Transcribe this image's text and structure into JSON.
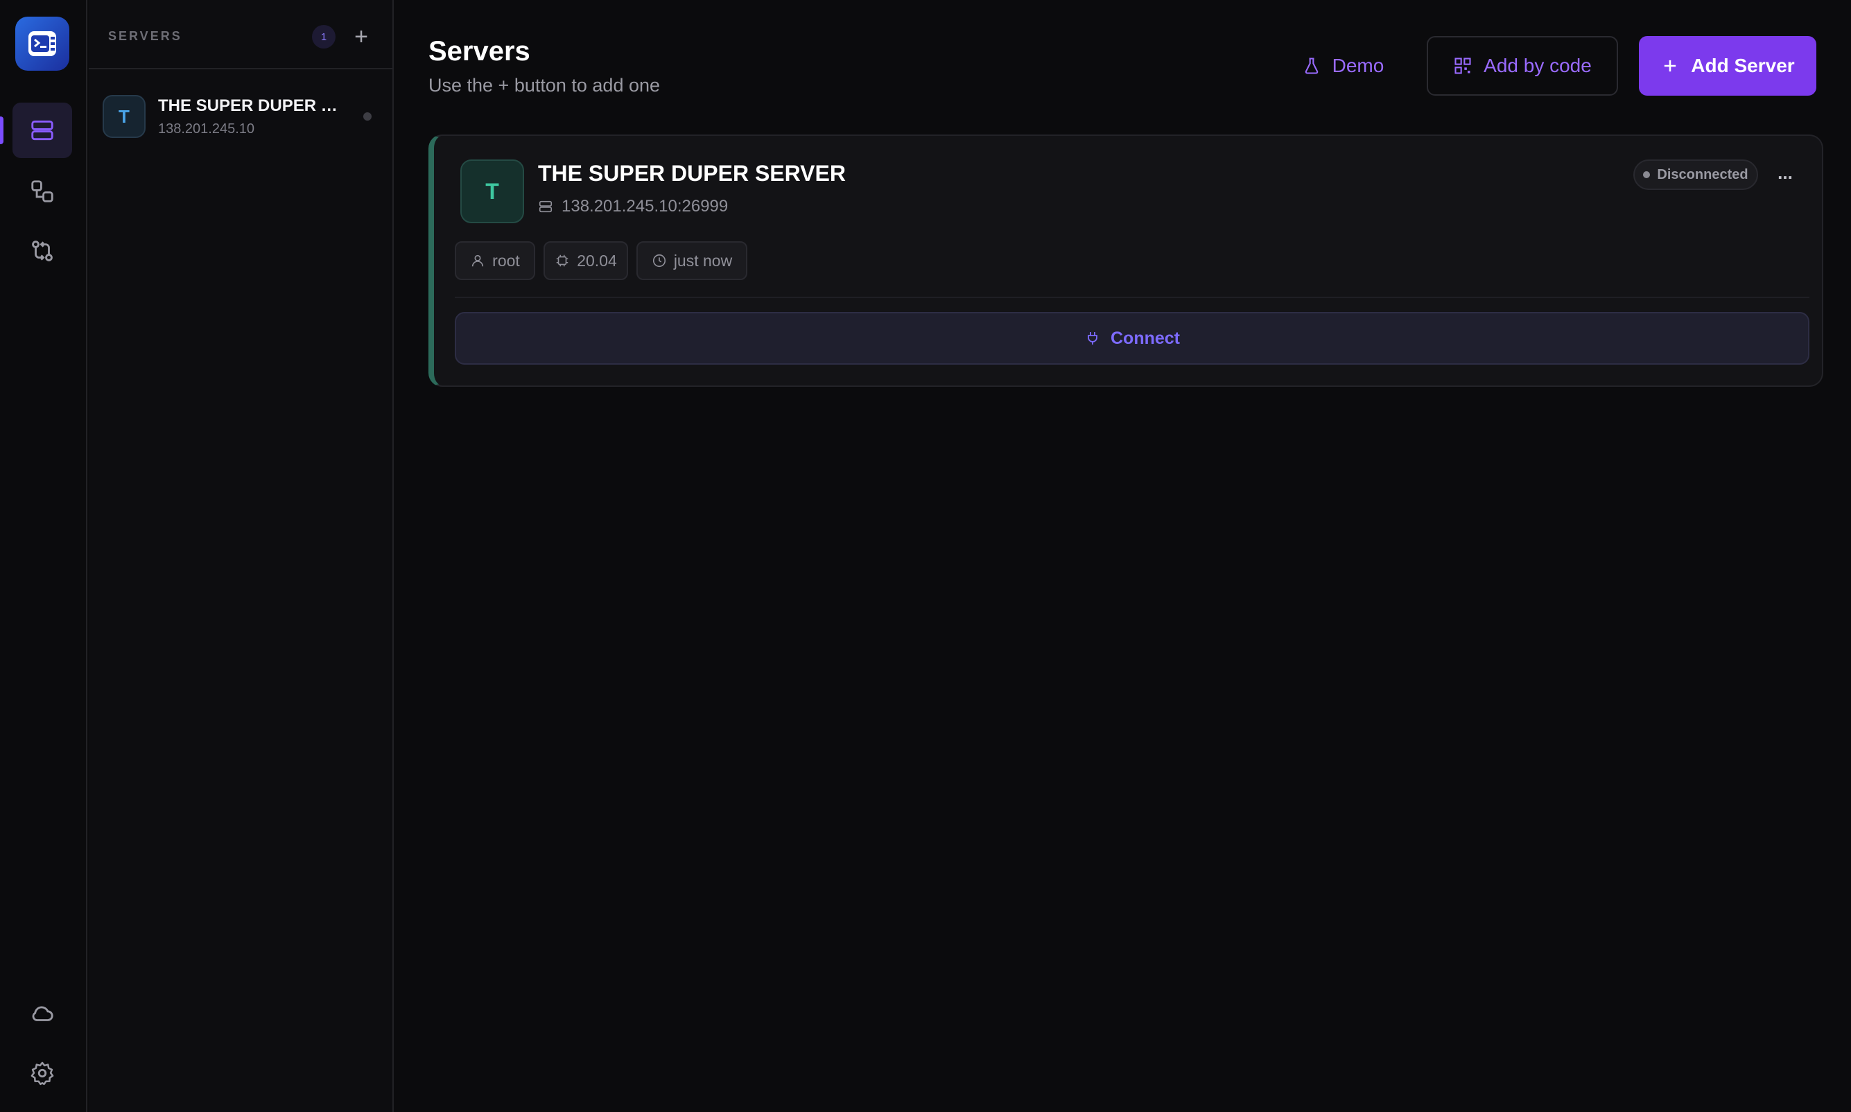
{
  "sidebar_panel": {
    "title": "SERVERS",
    "count": "1",
    "add_label": "+",
    "items": [
      {
        "initial": "T",
        "name": "THE SUPER DUPER SERVER",
        "ip": "138.201.245.10"
      }
    ]
  },
  "header": {
    "title": "Servers",
    "subtitle": "Use the + button to add one",
    "demo_label": "Demo",
    "add_by_code_label": "Add by code",
    "add_server_label": "Add Server"
  },
  "server_card": {
    "initial": "T",
    "name": "THE SUPER DUPER SERVER",
    "address": "138.201.245.10:26999",
    "status": "Disconnected",
    "more_label": "...",
    "user": "root",
    "os_version": "20.04",
    "last_seen": "just now",
    "connect_label": "Connect"
  },
  "colors": {
    "accent": "#7c3aed",
    "accent_text": "#9a6bff",
    "background": "#0b0b0d",
    "card_accent": "#2c6a5a"
  },
  "icons": {
    "rail": [
      "app-logo-icon",
      "servers-icon",
      "connections-icon",
      "transfer-icon",
      "cloud-icon",
      "settings-icon"
    ],
    "demo": "flask-icon",
    "add_by_code": "qr-code-icon",
    "add_server": "plus-icon",
    "address": "server-icon",
    "user": "user-icon",
    "os": "cpu-icon",
    "time": "clock-icon",
    "connect": "plug-icon"
  }
}
